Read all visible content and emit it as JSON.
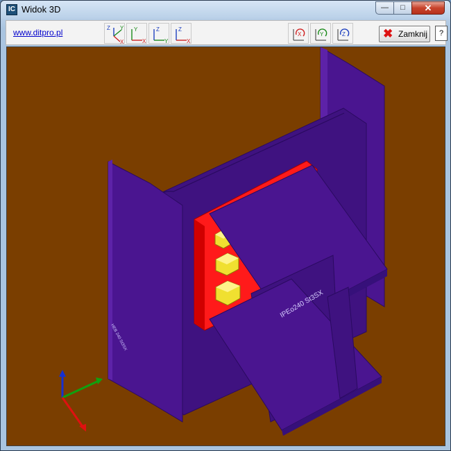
{
  "window": {
    "title": "Widok 3D",
    "icon_label": "IC"
  },
  "caption_buttons": {
    "minimize": "—",
    "maximize": "□",
    "close": "✕"
  },
  "toolbar": {
    "site_link": "www.ditpro.pl",
    "view_buttons": [
      {
        "name": "view-zyx-iso",
        "axes": [
          "Z",
          "Y",
          "X"
        ]
      },
      {
        "name": "view-yx",
        "axes": [
          "Y",
          "X"
        ]
      },
      {
        "name": "view-zy",
        "axes": [
          "Z",
          "Y"
        ]
      },
      {
        "name": "view-zx",
        "axes": [
          "Z",
          "X"
        ]
      }
    ],
    "rotate_buttons": [
      {
        "name": "rotate-x",
        "axis": "X",
        "color": "#d02020"
      },
      {
        "name": "rotate-y",
        "axis": "Y",
        "color": "#1a8a1a"
      },
      {
        "name": "rotate-z",
        "axis": "Z",
        "color": "#1d3fbf"
      }
    ],
    "close_label": "Zamknij",
    "help_label": "?"
  },
  "scene": {
    "background": "#7a3e00",
    "steel_color": "#4a1590",
    "plate_color": "#ff1a1a",
    "bolt_color": "#f0e030",
    "beam_label": "IPEo240 St3SX",
    "column_label": "HEB 240 St3SX"
  },
  "axes_gizmo": {
    "x": "#e01010",
    "y": "#10a010",
    "z": "#1530d0"
  }
}
